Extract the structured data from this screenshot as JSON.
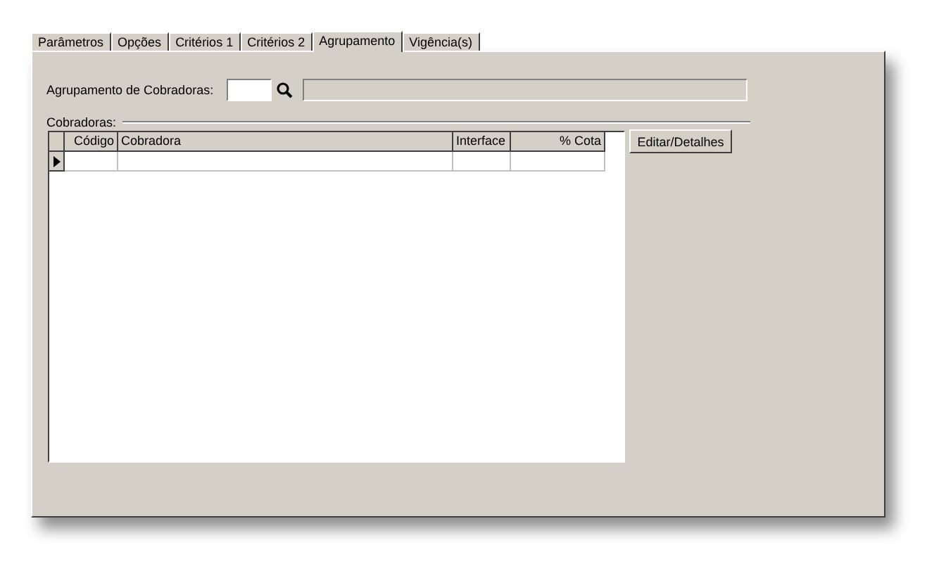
{
  "tabs": [
    {
      "label": "Parâmetros",
      "selected": false
    },
    {
      "label": "Opções",
      "selected": false
    },
    {
      "label": "Critérios 1",
      "selected": false
    },
    {
      "label": "Critérios 2",
      "selected": false
    },
    {
      "label": "Agrupamento",
      "selected": true
    },
    {
      "label": "Vigência(s)",
      "selected": false
    }
  ],
  "grouping": {
    "label": "Agrupamento de Cobradoras:"
  },
  "cobradoras": {
    "label": "Cobradoras:",
    "columns": [
      "Código",
      "Cobradora",
      "Interface",
      "% Cota"
    ]
  },
  "buttons": [
    "Editar/Detalhes"
  ]
}
